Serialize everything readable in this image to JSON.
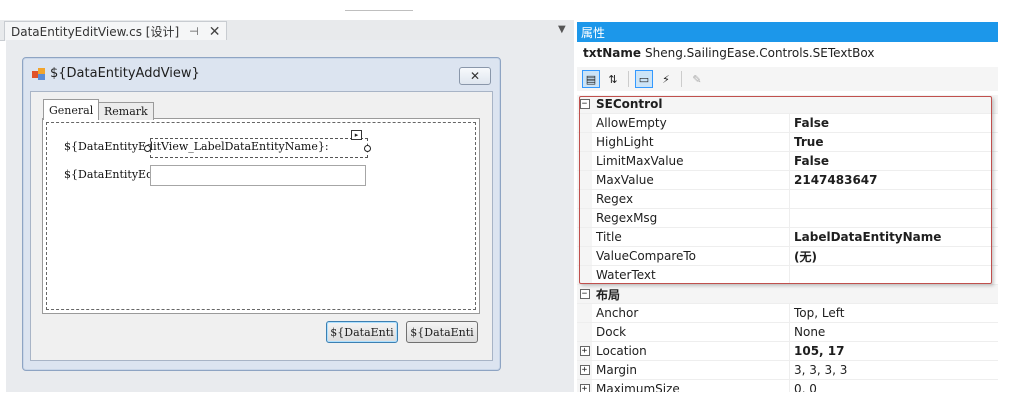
{
  "document_tab": {
    "title": "DataEntityEditView.cs [设计]",
    "pin": "⊣",
    "close": "✕"
  },
  "form": {
    "title": "${DataEntityAddView}",
    "close_glyph": "✕",
    "tabs": [
      {
        "label": "General"
      },
      {
        "label": "Remark"
      }
    ],
    "fields": [
      {
        "label": "${DataEntityEditView_LabelDataEntityName}:"
      },
      {
        "label": "${DataEntityEditView_LabelCode}:"
      }
    ],
    "buttons": [
      {
        "label": "${DataEnti"
      },
      {
        "label": "${DataEnti"
      }
    ]
  },
  "properties": {
    "header": "属性",
    "object_name": "txtName",
    "object_type": "Sheng.SailingEase.Controls.SETextBox",
    "categories": [
      {
        "name": "SEControl",
        "expander": "−",
        "rows": [
          {
            "name": "AllowEmpty",
            "value": "False",
            "bold": true
          },
          {
            "name": "HighLight",
            "value": "True",
            "bold": true
          },
          {
            "name": "LimitMaxValue",
            "value": "False",
            "bold": true
          },
          {
            "name": "MaxValue",
            "value": "2147483647",
            "bold": true
          },
          {
            "name": "Regex",
            "value": "",
            "bold": false
          },
          {
            "name": "RegexMsg",
            "value": "",
            "bold": false
          },
          {
            "name": "Title",
            "value": "LabelDataEntityName",
            "bold": true
          },
          {
            "name": "ValueCompareTo",
            "value": "(无)",
            "bold": true
          },
          {
            "name": "WaterText",
            "value": "",
            "bold": false
          }
        ]
      },
      {
        "name": "布局",
        "expander": "−",
        "rows": [
          {
            "name": "Anchor",
            "value": "Top, Left",
            "bold": false,
            "expander": ""
          },
          {
            "name": "Dock",
            "value": "None",
            "bold": false,
            "expander": ""
          },
          {
            "name": "Location",
            "value": "105, 17",
            "bold": true,
            "expander": "+"
          },
          {
            "name": "Margin",
            "value": "3, 3, 3, 3",
            "bold": false,
            "expander": "+"
          },
          {
            "name": "MaximumSize",
            "value": "0, 0",
            "bold": false,
            "expander": "+"
          }
        ]
      }
    ]
  }
}
